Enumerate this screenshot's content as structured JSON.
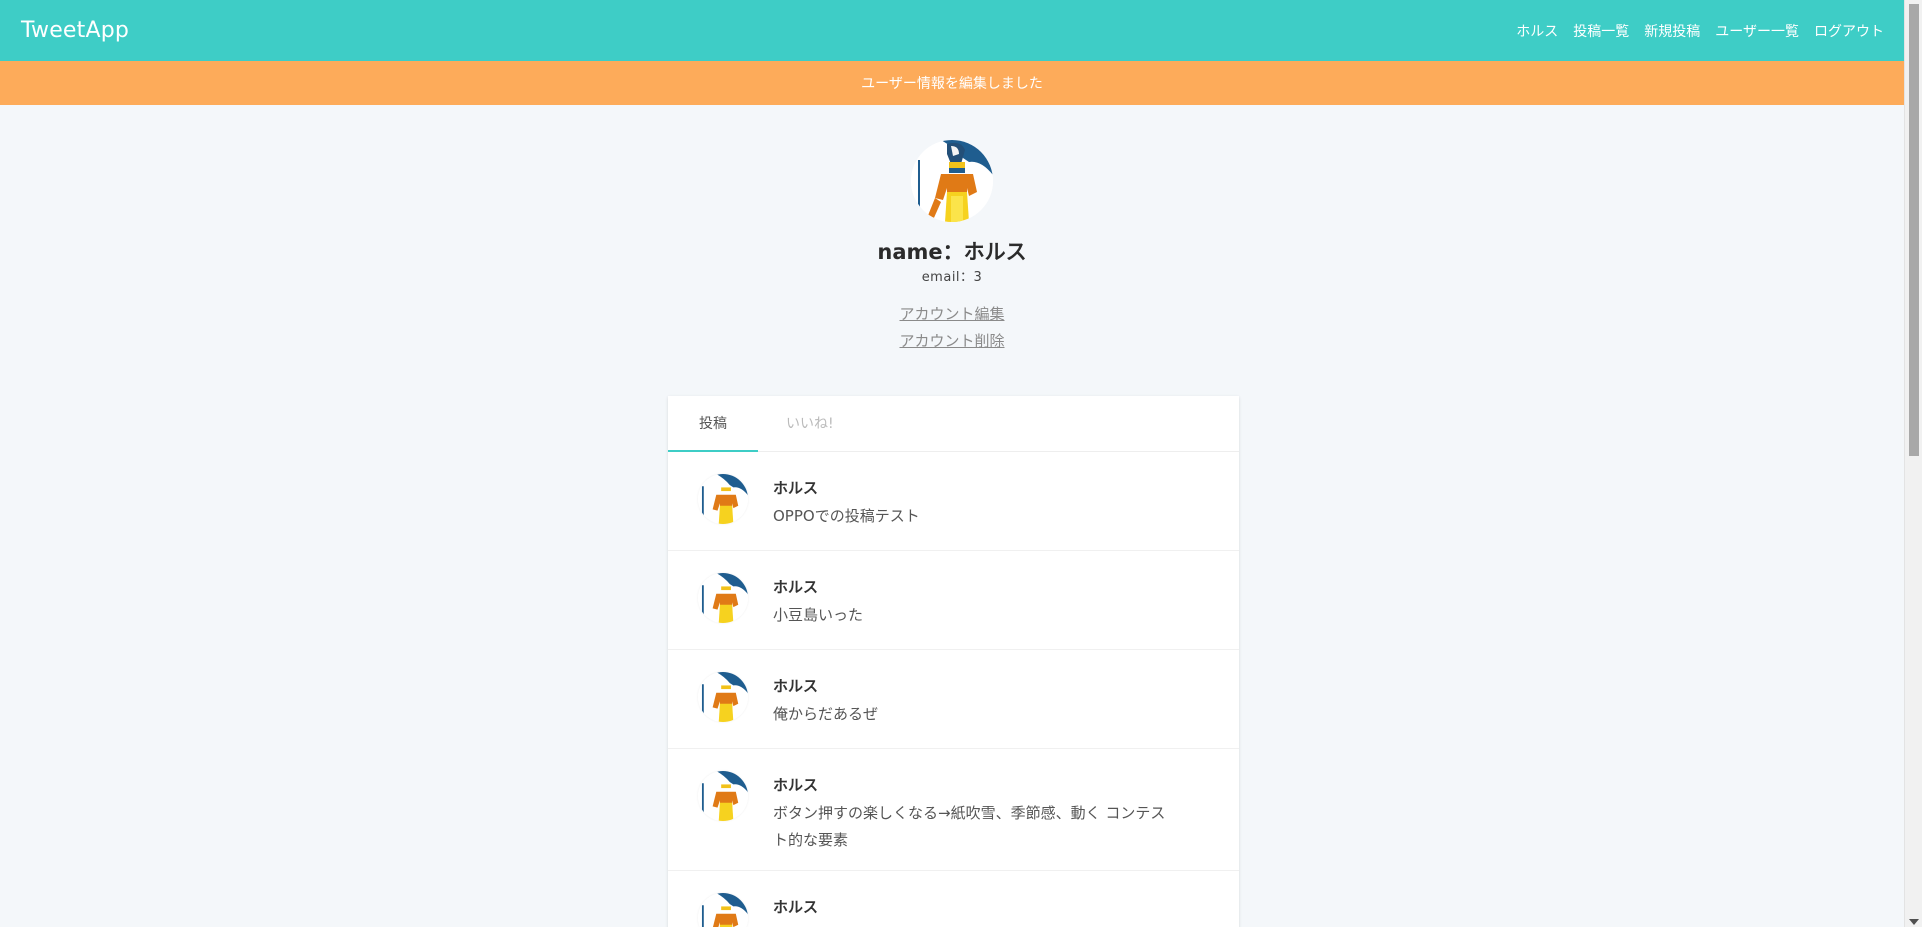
{
  "header": {
    "logo": "TweetApp",
    "nav": [
      "ホルス",
      "投稿一覧",
      "新規投稿",
      "ユーザー一覧",
      "ログアウト"
    ]
  },
  "flash": "ユーザー情報を編集しました",
  "profile": {
    "name": "name：ホルス",
    "email": "email：3",
    "edit_link": "アカウント編集",
    "delete_link": "アカウント削除"
  },
  "tabs": [
    "投稿",
    "いいね!"
  ],
  "posts": [
    {
      "user": "ホルス",
      "text": "OPPOでの投稿テスト"
    },
    {
      "user": "ホルス",
      "text": "小豆島いった"
    },
    {
      "user": "ホルス",
      "text": "俺からだあるぜ"
    },
    {
      "user": "ホルス",
      "text": "ボタン押すの楽しくなる→紙吹雪、季節感、動く コンテスト的な要素"
    },
    {
      "user": "ホルス",
      "text": ""
    }
  ],
  "colors": {
    "accent": "#3ecdc6",
    "flash": "#fdab5a",
    "background": "#f4f7fa"
  },
  "icons": {
    "avatar": "horus-figure-avatar-icon"
  }
}
